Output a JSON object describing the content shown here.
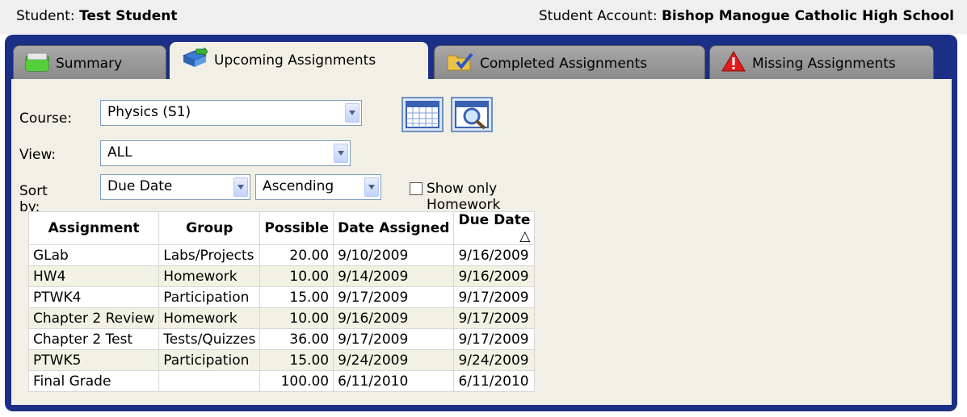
{
  "header": {
    "student_label": "Student:",
    "student_name": "Test Student",
    "account_label": "Student Account:",
    "account_name": "Bishop Manogue Catholic High School"
  },
  "tabs": [
    {
      "label": "Summary",
      "icon": "folder-icon"
    },
    {
      "label": "Upcoming Assignments",
      "icon": "book-arrow-icon"
    },
    {
      "label": "Completed Assignments",
      "icon": "folder-check-icon"
    },
    {
      "label": "Missing Assignments",
      "icon": "warning-icon"
    }
  ],
  "active_tab": "Upcoming Assignments",
  "filters": {
    "course_label": "Course:",
    "course_value": "Physics (S1)",
    "view_label": "View:",
    "view_value": "ALL",
    "sort_label": "Sort by:",
    "sort_value": "Due Date",
    "order_value": "Ascending",
    "homework_only_label": "Show only Homework Assignments",
    "homework_only_checked": false
  },
  "table": {
    "columns": [
      "Assignment",
      "Group",
      "Possible",
      "Date Assigned",
      "Due Date"
    ],
    "sort_indicator": "△",
    "rows": [
      [
        "GLab",
        "Labs/Projects",
        "20.00",
        "9/10/2009",
        "9/16/2009"
      ],
      [
        "HW4",
        "Homework",
        "10.00",
        "9/14/2009",
        "9/16/2009"
      ],
      [
        "PTWK4",
        "Participation",
        "15.00",
        "9/17/2009",
        "9/17/2009"
      ],
      [
        "Chapter 2 Review",
        "Homework",
        "10.00",
        "9/16/2009",
        "9/17/2009"
      ],
      [
        "Chapter 2 Test",
        "Tests/Quizzes",
        "36.00",
        "9/17/2009",
        "9/17/2009"
      ],
      [
        "PTWK5",
        "Participation",
        "15.00",
        "9/24/2009",
        "9/24/2009"
      ],
      [
        "Final Grade",
        "",
        "100.00",
        "6/11/2010",
        "6/11/2010"
      ]
    ]
  },
  "colors": {
    "frame": "#1b2f86",
    "panel": "#f2f0e6",
    "tab_inactive": "#9a9a9a"
  }
}
